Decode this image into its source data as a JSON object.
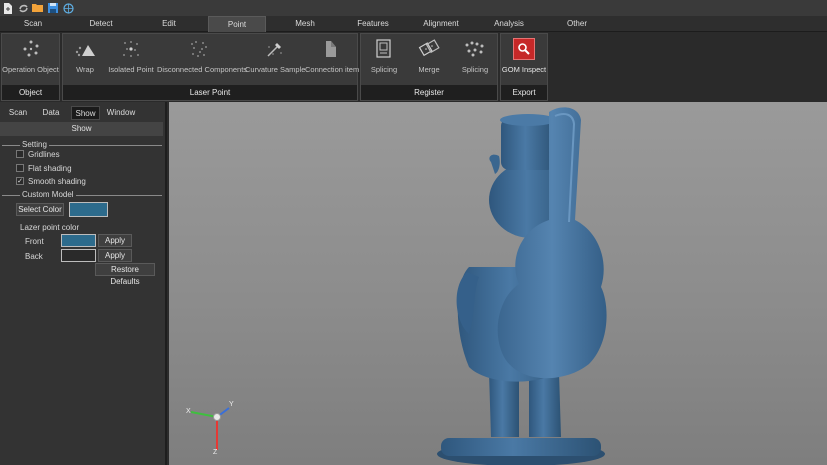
{
  "menu": {
    "tabs": [
      {
        "label": "Scan"
      },
      {
        "label": "Detect"
      },
      {
        "label": "Edit"
      },
      {
        "label": "Point"
      },
      {
        "label": "Mesh"
      },
      {
        "label": "Features"
      },
      {
        "label": "Alignment"
      },
      {
        "label": "Analysis"
      },
      {
        "label": "Other"
      }
    ],
    "active": "Point"
  },
  "ribbon": {
    "object_group": {
      "label": "Object",
      "buttons": [
        {
          "label": "Operation Object",
          "icon": "dots-circle-icon"
        }
      ]
    },
    "laser_group": {
      "label": "Laser Point",
      "buttons": [
        {
          "label": "Wrap",
          "icon": "wrap-icon"
        },
        {
          "label": "Isolated Point",
          "icon": "isolated-point-icon"
        },
        {
          "label": "Disconnected Components",
          "icon": "disconnected-components-icon"
        },
        {
          "label": "Curvature Sample",
          "icon": "curvature-sample-icon"
        },
        {
          "label": "Connection item",
          "icon": "connection-item-icon"
        }
      ]
    },
    "register_group": {
      "label": "Register",
      "buttons": [
        {
          "label": "Splicing",
          "icon": "splicing-doc-icon"
        },
        {
          "label": "Merge",
          "icon": "merge-icon"
        },
        {
          "label": "Splicing",
          "icon": "splicing-dots-icon"
        }
      ]
    },
    "export_group": {
      "label": "Export",
      "buttons": [
        {
          "label": "GOM Inspect",
          "icon": "gom-inspect-icon"
        }
      ]
    }
  },
  "panel": {
    "tabs": [
      {
        "label": "Scan"
      },
      {
        "label": "Data"
      },
      {
        "label": "Show"
      },
      {
        "label": "Window"
      }
    ],
    "active_tab": "Show",
    "header": "Show",
    "setting": {
      "title": "Setting",
      "options": [
        {
          "label": "Gridlines",
          "checked": false
        },
        {
          "label": "Flat shading",
          "checked": false
        },
        {
          "label": "Smooth shading",
          "checked": true
        }
      ]
    },
    "custom_model": {
      "title": "Custom Model",
      "select_color_label": "Select Color",
      "model_color": "#2d6b8c"
    },
    "lazer": {
      "title": "Lazer point color",
      "front_label": "Front",
      "front_color": "#2d6b8c",
      "back_label": "Back",
      "back_color": "#2a2a2a",
      "apply_label": "Apply",
      "restore_label": "Restore Defaults"
    }
  },
  "viewport": {
    "model_color": "#3f6b94",
    "axes": {
      "x_label": "X",
      "y_label": "Y",
      "z_label": "Z"
    }
  }
}
